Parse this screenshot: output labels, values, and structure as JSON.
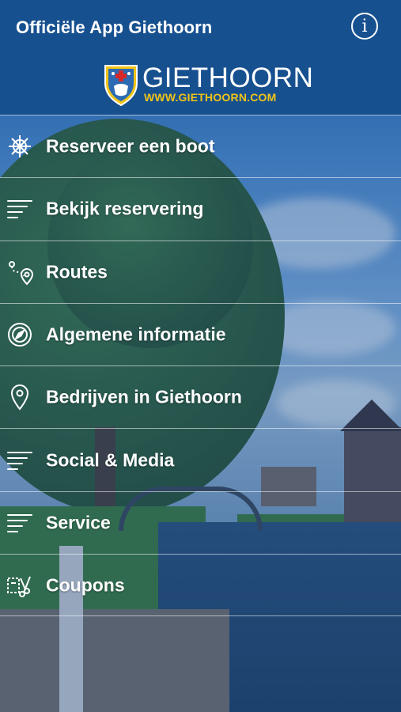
{
  "header": {
    "title": "Officiële App Giethoorn",
    "info_icon": "info-icon",
    "logo": {
      "name": "GIETHOORN",
      "url": "WWW.GIETHOORN.COM"
    }
  },
  "menu": {
    "items": [
      {
        "label": "Reserveer een boot",
        "icon": "ship-wheel-icon"
      },
      {
        "label": "Bekijk reservering",
        "icon": "list-icon"
      },
      {
        "label": "Routes",
        "icon": "route-icon"
      },
      {
        "label": "Algemene informatie",
        "icon": "compass-icon"
      },
      {
        "label": "Bedrijven in Giethoorn",
        "icon": "location-pin-icon"
      },
      {
        "label": "Social & Media",
        "icon": "list-icon"
      },
      {
        "label": "Service",
        "icon": "list-icon"
      },
      {
        "label": "Coupons",
        "icon": "coupon-scissors-icon"
      }
    ]
  },
  "colors": {
    "header_bg": "#17508f",
    "logo_url": "#f1c417",
    "text": "#ffffff"
  }
}
